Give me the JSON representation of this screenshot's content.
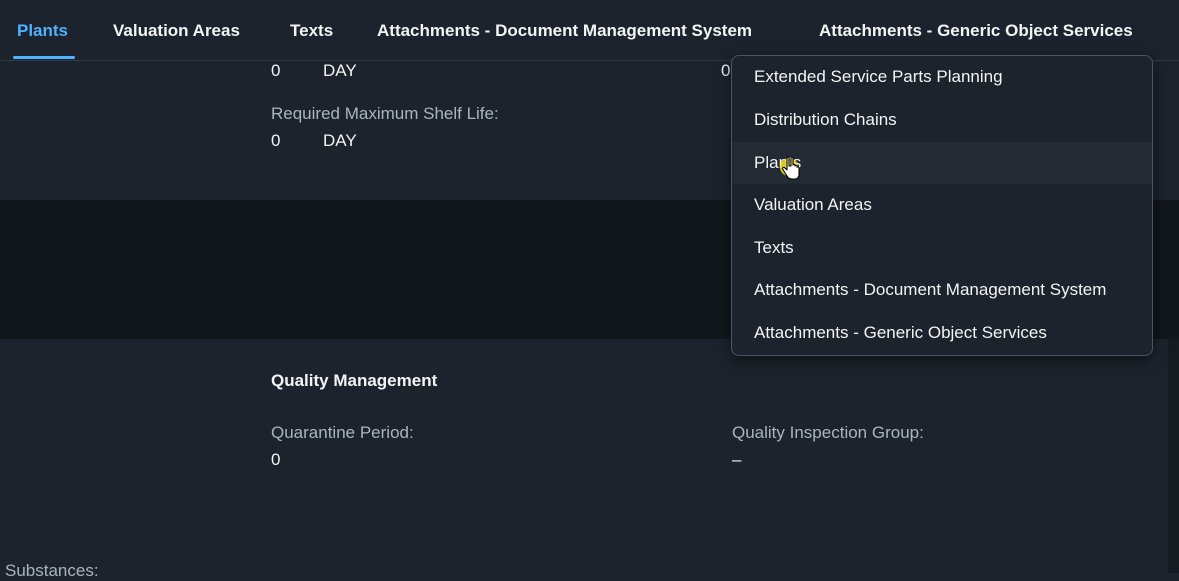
{
  "tabs": [
    {
      "label": "Plants",
      "active": true
    },
    {
      "label": "Valuation Areas"
    },
    {
      "label": "Texts"
    },
    {
      "label": "Attachments - Document Management System"
    },
    {
      "label": "Attachments - Generic Object Services"
    }
  ],
  "top_section": {
    "row1_value": "0",
    "row1_unit": "DAY",
    "row1_right_value": "0",
    "required_max_shelf_life_label": "Required Maximum Shelf Life:",
    "required_max_shelf_life_value": "0",
    "required_max_shelf_life_unit": "DAY"
  },
  "quality_management": {
    "title": "Quality Management",
    "quarantine_period_label": "Quarantine Period:",
    "quarantine_period_value": "0",
    "quality_inspection_group_label": "Quality Inspection Group:",
    "quality_inspection_group_value": "–"
  },
  "substances_label": "Substances:",
  "overflow_menu": {
    "items": [
      {
        "label": "Extended Service Parts Planning"
      },
      {
        "label": "Distribution Chains"
      },
      {
        "label": "Plants",
        "hovered": true
      },
      {
        "label": "Valuation Areas"
      },
      {
        "label": "Texts"
      },
      {
        "label": "Attachments - Document Management System"
      },
      {
        "label": "Attachments - Generic Object Services"
      }
    ]
  },
  "colors": {
    "accent": "#4db1ff",
    "background": "#1d232c",
    "dark_band": "#12171c",
    "label": "#a9b4be",
    "text": "#f2f4f5",
    "cursor": "#f5e51c"
  },
  "icons": {
    "cursor": "hand-pointer-icon"
  }
}
